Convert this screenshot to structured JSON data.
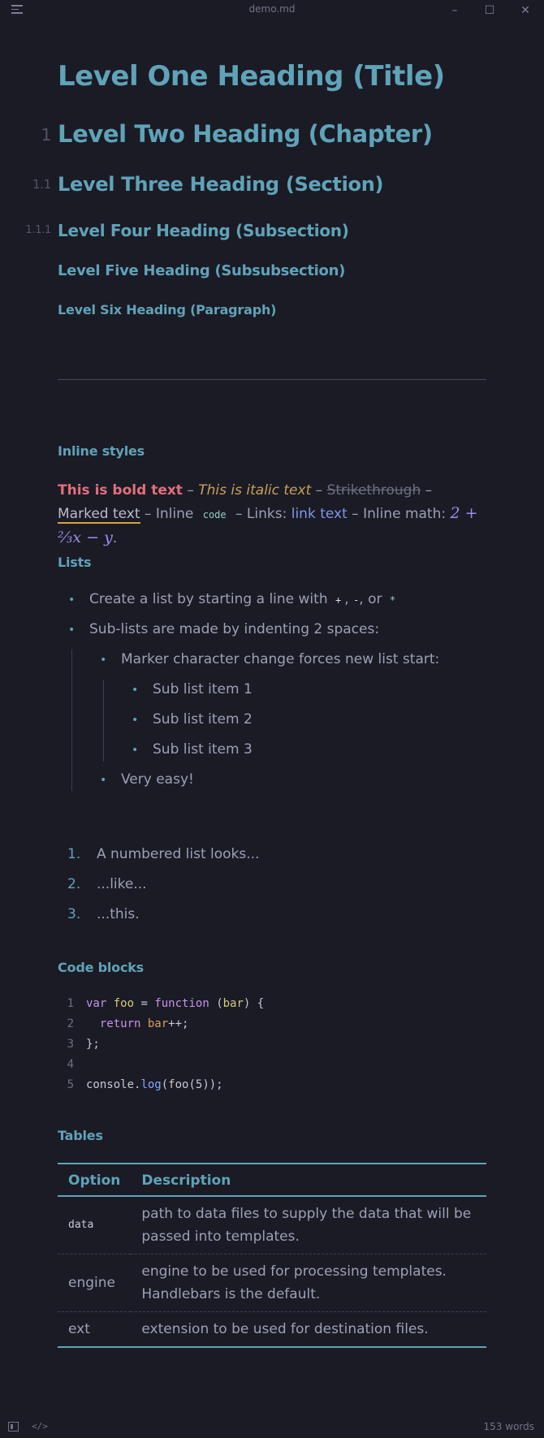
{
  "window": {
    "title": "demo.md",
    "controls": [
      "minimize",
      "maximize",
      "close"
    ]
  },
  "headings": {
    "h1": "Level One Heading (Title)",
    "h2": {
      "num": "1",
      "text": "Level Two Heading (Chapter)"
    },
    "h3": {
      "num": "1.1",
      "text": "Level Three Heading (Section)"
    },
    "h4": {
      "num": "1.1.1",
      "text": "Level Four Heading (Subsection)"
    },
    "h5": "Level Five Heading (Subsubsection)",
    "h6": "Level Six Heading (Paragraph)"
  },
  "inline": {
    "title": "Inline styles",
    "bold": "This is bold text",
    "sep1": " – ",
    "italic": "This is italic text",
    "sep2": " – ",
    "strike": "Strikethrough",
    "sep3": " – ",
    "marked": "Marked text",
    "inline_prefix": " – Inline ",
    "code": "code",
    "links_prefix": " – Links: ",
    "link": "link text",
    "math_prefix": " – Inline math: ",
    "math": "2 + ⅔x − y",
    "end": "."
  },
  "lists": {
    "title": "Lists",
    "item1_pre": "Create a list by starting a line with ",
    "item1_plus": "+",
    "item1_comma1": ", ",
    "item1_minus": "-",
    "item1_comma2": ", or ",
    "item1_star": "*",
    "item2": "Sub-lists are made by indenting 2 spaces:",
    "sub1": "Marker character change forces new list start:",
    "subsub": [
      "Sub list item 1",
      "Sub list item 2",
      "Sub list item 3"
    ],
    "sub2": "Very easy!",
    "ordered": [
      {
        "num": "1.",
        "text": "A numbered list looks..."
      },
      {
        "num": "2.",
        "text": "...like..."
      },
      {
        "num": "3.",
        "text": "...this."
      }
    ]
  },
  "code": {
    "title": "Code blocks",
    "lines": [
      "1",
      "2",
      "3",
      "4",
      "5"
    ],
    "t_var": "var",
    "t_foo": "foo",
    "t_eq": " = ",
    "t_function": "function",
    "t_open": " (",
    "t_bar": "bar",
    "t_close": ") {",
    "t_indent": "  ",
    "t_return": "return",
    "t_sp": " ",
    "t_bar2": "bar",
    "t_pp": "++;",
    "t_end": "};",
    "t_console": "console",
    "t_dot": ".",
    "t_log": "log",
    "t_rest": "(foo(5));"
  },
  "tables": {
    "title": "Tables",
    "headers": [
      "Option",
      "Description"
    ],
    "rows": [
      [
        "data",
        "path to data files to supply the data that will be passed into templates."
      ],
      [
        "engine",
        "engine to be used for processing templates. Handlebars is the default."
      ],
      [
        "ext",
        "extension to be used for destination files."
      ]
    ]
  },
  "status": {
    "word_count": "153 words",
    "toggle_sidebar_icon": "sidebar-icon",
    "source_icon": "code-icon"
  }
}
